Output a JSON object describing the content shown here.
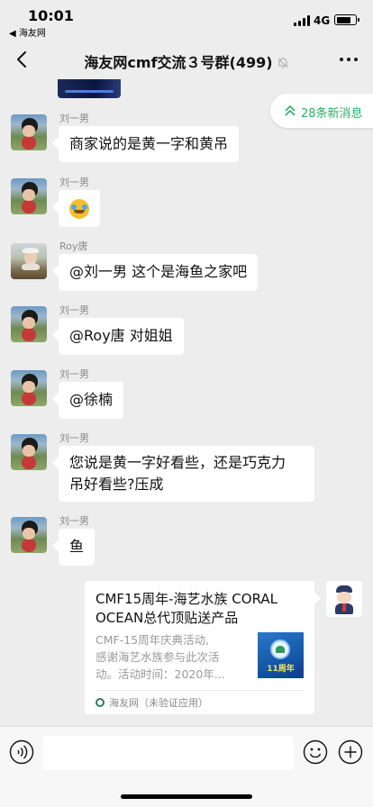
{
  "status_bar": {
    "time": "10:01",
    "back_app": "◀ 海友网",
    "network": "4G",
    "battery_level": 0.82
  },
  "nav": {
    "title": "海友网cmf交流３号群(499)",
    "muted": true
  },
  "new_messages": {
    "label": "28条新消息"
  },
  "messages": [
    {
      "sender": "刘一男",
      "avatar": "liu-avatar",
      "text": "商家说的是黄一字和黄吊"
    },
    {
      "sender": "刘一男",
      "avatar": "liu-avatar",
      "emoji": "grinning-sweat-emoji"
    },
    {
      "sender": "Roy唐",
      "avatar": "roy-avatar",
      "text": "@刘一男 这个是海鱼之家吧"
    },
    {
      "sender": "刘一男",
      "avatar": "liu-avatar",
      "text": "@Roy唐 对姐姐"
    },
    {
      "sender": "刘一男",
      "avatar": "liu-avatar",
      "text": "@徐楠"
    },
    {
      "sender": "刘一男",
      "avatar": "liu-avatar",
      "line1": "您说是黄一字好看些，还是巧克力",
      "line2": "吊好看些?压成"
    },
    {
      "sender": "刘一男",
      "avatar": "liu-avatar",
      "text": "鱼"
    }
  ],
  "link_card": {
    "title": "CMF15周年-海艺水族 CORAL OCEAN总代顶贴送产品",
    "desc_line1": "CMF-15周年庆典活动,",
    "desc_line2": "感谢海艺水族参与此次活",
    "desc_line3": "动。活动时间：2020年...",
    "thumb_text": "11周年",
    "source": "海友网（未验证应用）"
  },
  "input": {
    "value": "",
    "placeholder": ""
  },
  "colors": {
    "background": "#ededed",
    "bubble": "#ffffff",
    "accent_green": "#2aae67"
  }
}
